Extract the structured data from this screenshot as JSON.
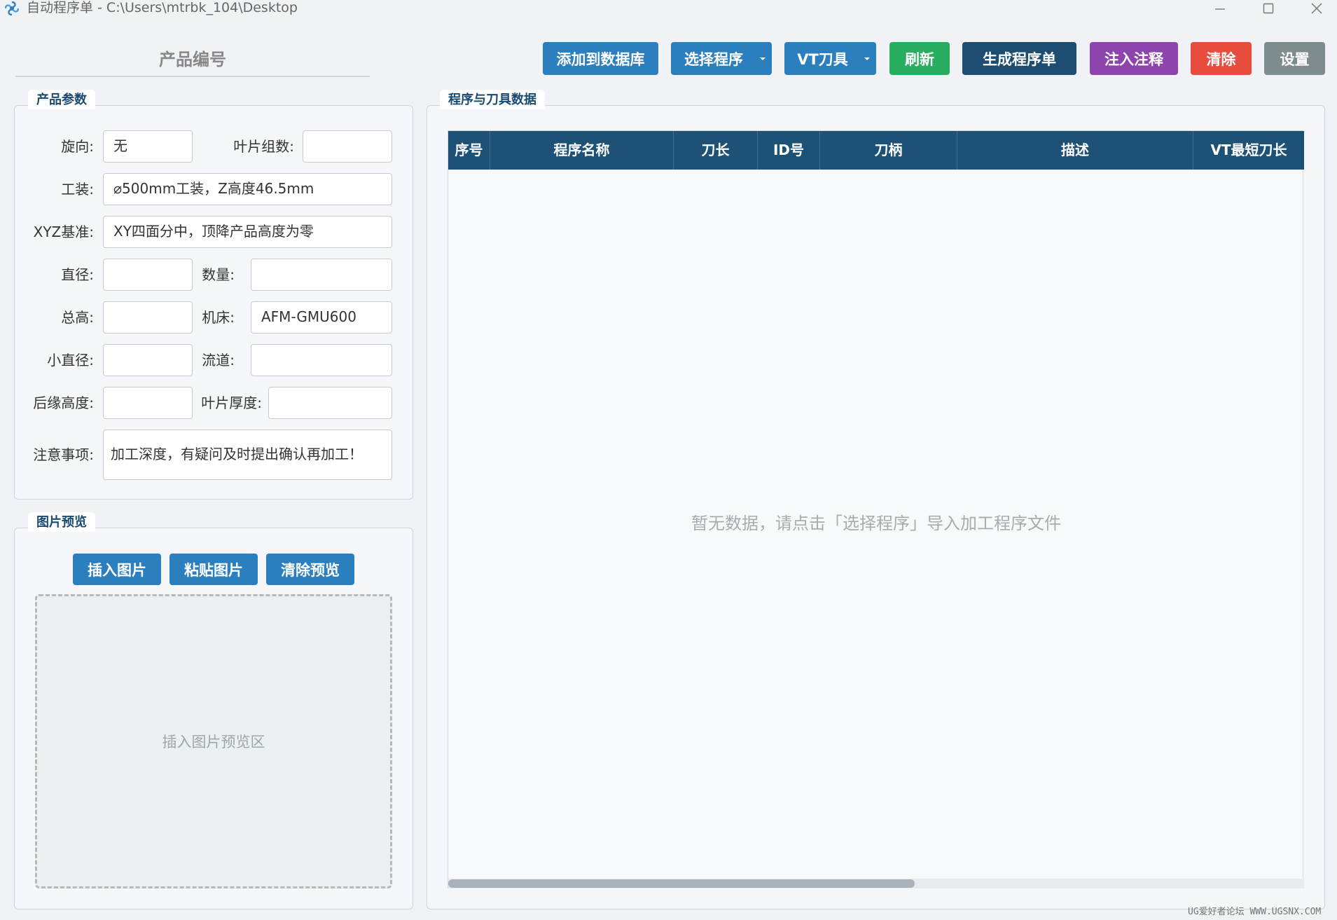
{
  "window": {
    "title": "自动程序单 - C:\\Users\\mtrbk_104\\Desktop",
    "app_icon": "app-swirl-icon",
    "controls": [
      "minimize-icon",
      "maximize-icon",
      "close-icon"
    ]
  },
  "product_number": {
    "label": "产品编号"
  },
  "toolbar": {
    "add_to_db": "添加到数据库",
    "select_program": "选择程序",
    "vt_tools": "VT刀具",
    "refresh": "刷新",
    "generate": "生成程序单",
    "inject_comments": "注入注释",
    "clear": "清除",
    "settings": "设置"
  },
  "colors": {
    "primary": "#2b7fbf",
    "green": "#27ae60",
    "dark_navy": "#1d4e72",
    "purple": "#8e44ad",
    "red": "#e74c3c",
    "gray": "#7f8c8d",
    "table_header": "#1d5176"
  },
  "product_params": {
    "title": "产品参数",
    "rotation_label": "旋向:",
    "rotation_value": "无",
    "blade_groups_label": "叶片组数:",
    "blade_groups_value": "",
    "fixture_label": "工装:",
    "fixture_value": "⌀500mm工装，Z高度46.5mm",
    "xyz_label": "XYZ基准:",
    "xyz_value": "XY四面分中，顶降产品高度为零",
    "diameter_label": "直径:",
    "diameter_value": "",
    "quantity_label": "数量:",
    "quantity_value": "",
    "total_height_label": "总高:",
    "total_height_value": "",
    "machine_label": "机床:",
    "machine_value": "AFM-GMU600",
    "small_diameter_label": "小直径:",
    "small_diameter_value": "",
    "flow_channel_label": "流道:",
    "flow_channel_value": "",
    "trailing_height_label": "后缘高度:",
    "trailing_height_value": "",
    "blade_thickness_label": "叶片厚度:",
    "blade_thickness_value": "",
    "notes_label": "注意事项:",
    "notes_value": "加工深度，有疑问及时提出确认再加工！"
  },
  "image_preview": {
    "title": "图片预览",
    "insert": "插入图片",
    "paste": "粘贴图片",
    "clear": "清除预览",
    "hint": "插入图片预览区"
  },
  "program_table": {
    "title": "程序与刀具数据",
    "columns": [
      "序号",
      "程序名称",
      "刀长",
      "ID号",
      "刀柄",
      "描述",
      "VT最短刀长"
    ],
    "rows": [],
    "empty_hint": "暂无数据，请点击「选择程序」导入加工程序文件"
  },
  "watermark": "UG爱好者论坛 WWW.UGSNX.COM"
}
